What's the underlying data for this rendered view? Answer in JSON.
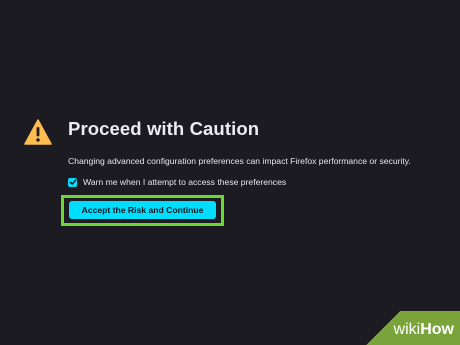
{
  "page": {
    "title": "Proceed with Caution",
    "description": "Changing advanced configuration preferences can impact Firefox performance or security.",
    "checkbox": {
      "label": "Warn me when I attempt to access these preferences",
      "checked": true
    },
    "accept_button_label": "Accept the Risk and Continue"
  },
  "icons": {
    "warning": "warning-triangle-icon",
    "checkmark": "checkmark-icon"
  },
  "watermark": {
    "brand_part1": "wiki",
    "brand_part2": "How"
  },
  "colors": {
    "background": "#1c1b22",
    "accent": "#00ddff",
    "warning": "#ffbd4f",
    "highlight": "#6ad932",
    "watermark": "#7aa43a"
  }
}
